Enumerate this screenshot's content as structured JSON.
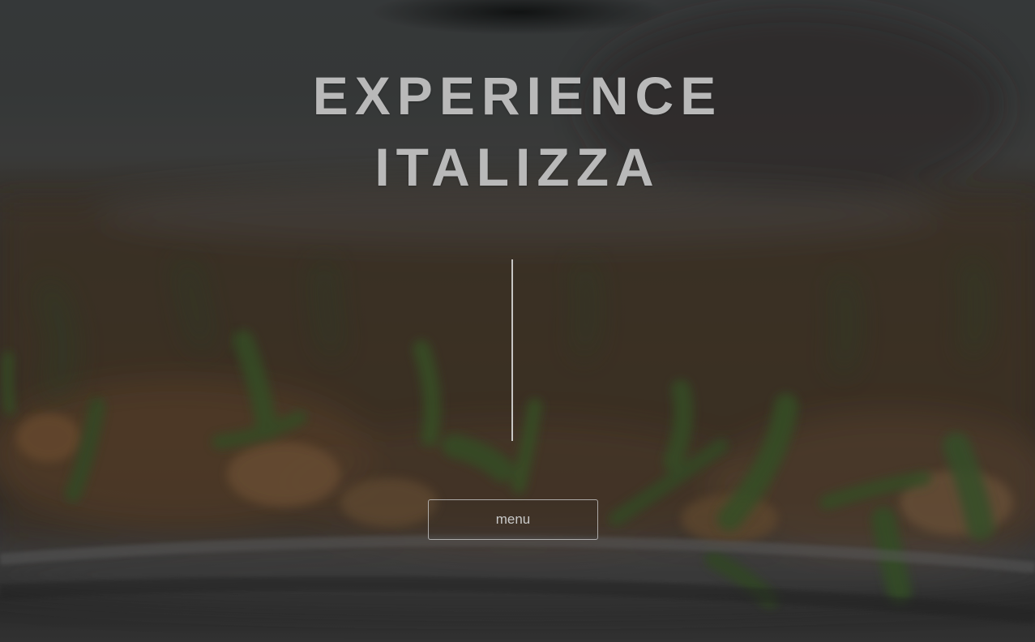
{
  "hero": {
    "headline_line1": "EXPERIENCE",
    "headline_line2": "ITALIZZA",
    "menu_label": "menu"
  },
  "colors": {
    "headline": "#b9b9b9",
    "divider": "#e1e1e1",
    "button_border": "#d2d2d2",
    "button_text": "#c9c9c9",
    "overlay": "#121212"
  }
}
